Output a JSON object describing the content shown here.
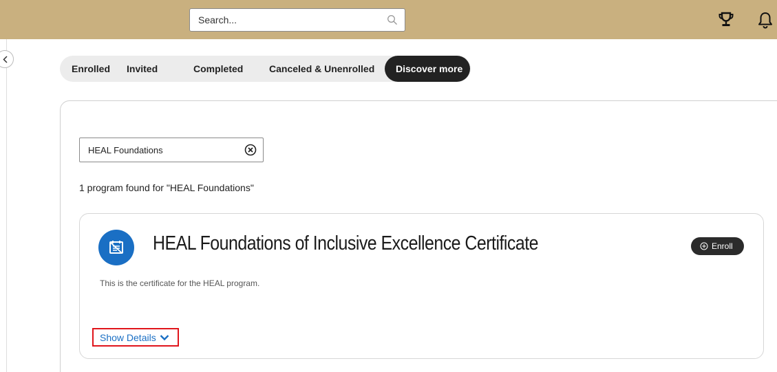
{
  "header": {
    "search_placeholder": "Search...",
    "icons": [
      "search-icon",
      "trophy-icon",
      "bell-icon"
    ]
  },
  "tabs": [
    {
      "label": "Enrolled",
      "active": false
    },
    {
      "label": "Invited",
      "active": false
    },
    {
      "label": "Completed",
      "active": false
    },
    {
      "label": "Canceled & Unenrolled",
      "active": false
    },
    {
      "label": "Discover more",
      "active": true
    }
  ],
  "filter": {
    "value": "HEAL Foundations"
  },
  "results": {
    "summary": "1 program found for \"HEAL Foundations\""
  },
  "program": {
    "title": "HEAL Foundations of Inclusive Excellence Certificate",
    "description": "This is the certificate for the HEAL program.",
    "enroll_label": "Enroll",
    "show_details_label": "Show Details"
  },
  "colors": {
    "header_bg": "#c9b07f",
    "accent_blue": "#1a6fc4",
    "dark_pill": "#222222",
    "highlight_red": "#e0141a"
  }
}
